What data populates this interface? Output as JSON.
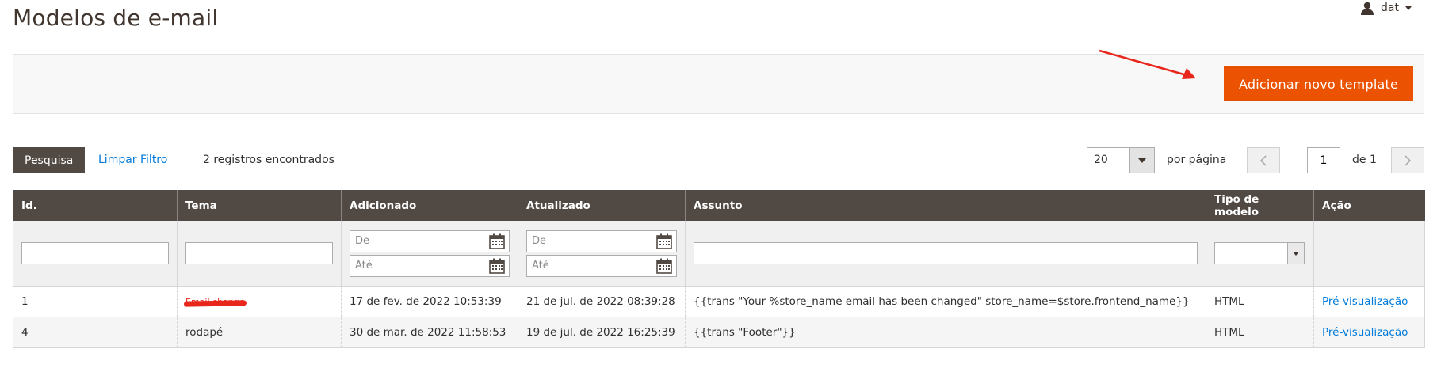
{
  "page": {
    "title": "Modelos de e-mail"
  },
  "user": {
    "name": "dat"
  },
  "actions": {
    "add_label": "Adicionar novo template"
  },
  "toolbar": {
    "search_label": "Pesquisa",
    "reset_label": "Limpar Filtro",
    "records_text": "2 registros encontrados",
    "per_page_value": "20",
    "per_page_label": "por página",
    "page_value": "1",
    "of_pages": "de 1"
  },
  "columns": [
    "Id.",
    "Tema",
    "Adicionado",
    "Atualizado",
    "Assunto",
    "Tipo de modelo",
    "Ação"
  ],
  "filters": {
    "from_placeholder": "De",
    "to_placeholder": "Até"
  },
  "rows": [
    {
      "id": "1",
      "tema": "Email change",
      "added": "17 de fev. de 2022 10:53:39",
      "updated": "21 de jul. de 2022 08:39:28",
      "subject": "{{trans \"Your %store_name email has been changed\" store_name=$store.frontend_name}}",
      "type": "HTML",
      "action": "Pré-visualização"
    },
    {
      "id": "4",
      "tema": "rodapé",
      "added": "30 de mar. de 2022 11:58:53",
      "updated": "19 de jul. de 2022 16:25:39",
      "subject": "{{trans \"Footer\"}}",
      "type": "HTML",
      "action": "Pré-visualização"
    }
  ],
  "icons": {
    "user": "user-icon",
    "calendar": "calendar-icon",
    "prev": "chevron-left-icon",
    "next": "chevron-right-icon"
  },
  "colors": {
    "accent": "#eb5202",
    "header": "#514943",
    "link": "#007bdb",
    "annotation": "#e8261c"
  }
}
